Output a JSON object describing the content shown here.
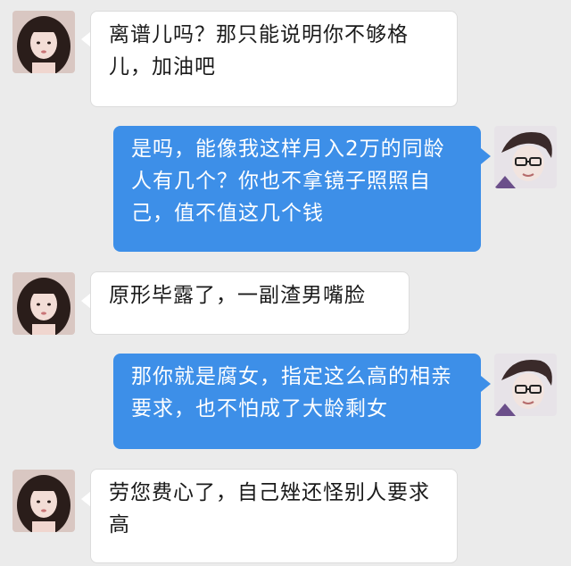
{
  "chat": {
    "messages": [
      {
        "side": "in",
        "text": "离谱儿吗？那只能说明你不够格儿，加油吧"
      },
      {
        "side": "out",
        "text": "是吗，能像我这样月入2万的同龄人有几个？你也不拿镜子照照自己，值不值这几个钱"
      },
      {
        "side": "in",
        "text": "原形毕露了，一副渣男嘴脸"
      },
      {
        "side": "out",
        "text": "那你就是腐女，指定这么高的相亲要求，也不怕成了大龄剩女"
      },
      {
        "side": "in",
        "text": "劳您费心了，自己矬还怪别人要求高"
      }
    ]
  },
  "colors": {
    "background": "#ebebeb",
    "incoming_bubble": "#ffffff",
    "outgoing_bubble": "#3d8fe8"
  },
  "icons": {
    "left_avatar": "girl-avatar",
    "right_avatar": "boy-avatar-with-glasses"
  }
}
